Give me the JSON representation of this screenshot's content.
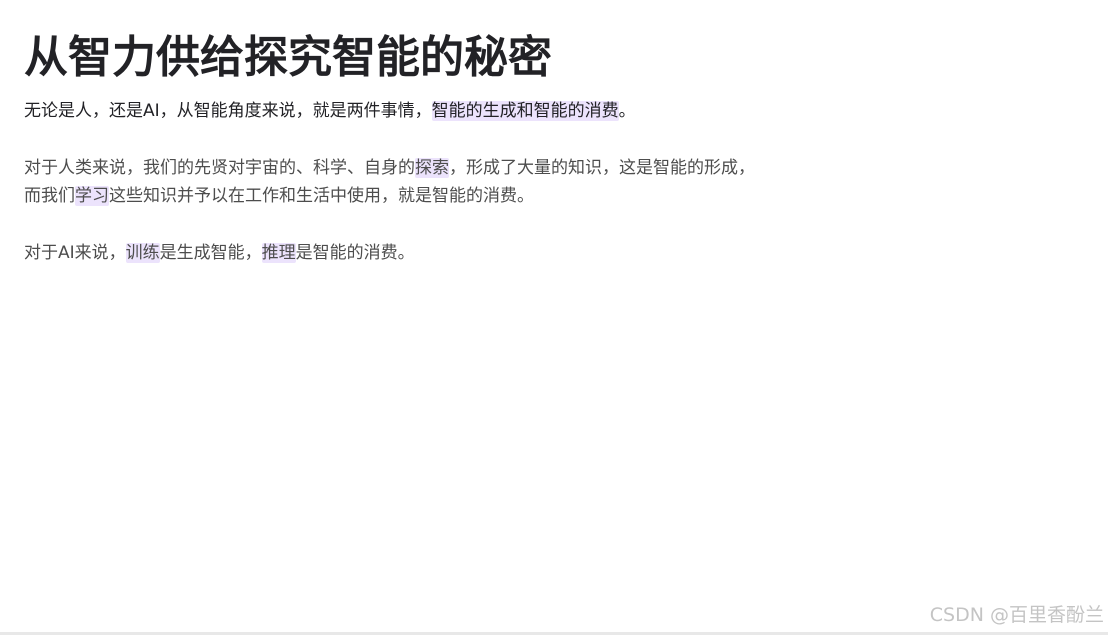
{
  "title": "从智力供给探究智能的秘密",
  "paragraph1": {
    "text": "无论是人，还是AI，从智能角度来说，就是两件事情，",
    "highlight": "智能的生成和智能的消费",
    "end": "。"
  },
  "paragraph2": {
    "line1_a": "对于人类来说，我们的先贤对宇宙的、科学、自身的",
    "line1_highlight": "探索",
    "line1_b": "，形成了大量的知识，这是智能的形成，",
    "line2_a": "而我们",
    "line2_highlight": "学习",
    "line2_b": "这些知识并予以在工作和生活中使用，就是智能的消费。"
  },
  "paragraph3": {
    "a": "对于AI来说，",
    "highlight1": "训练",
    "b": "是生成智能，",
    "highlight2": "推理",
    "c": "是智能的消费。"
  },
  "watermark": "CSDN @百里香酚兰"
}
